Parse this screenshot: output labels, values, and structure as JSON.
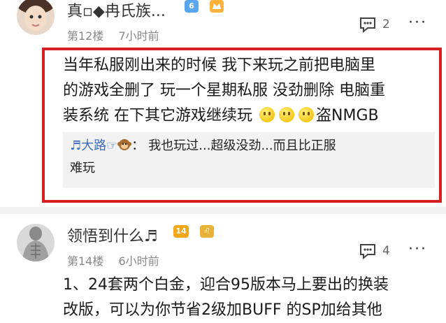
{
  "comments": [
    {
      "username": "真▫◆冉氏族...",
      "level_badge": "6",
      "floor": "第12楼",
      "time": "7小时前",
      "reply_count": "2",
      "content_lines": [
        "当年私服刚出来的时候 我下来玩之前把电脑里",
        "的游戏全删了 玩一个星期私服 没劲删除 电脑重",
        "装系统 在下其它游戏继续玩"
      ],
      "content_tail": "盗NMGB",
      "sub_reply": {
        "author": "♬大路☞",
        "separator": "：",
        "text_line1": "我也玩过...超级没劲...而且比正服",
        "text_line2": "难玩"
      }
    },
    {
      "username": "领悟到什么♬",
      "level_badge": "14",
      "zodiac_badge": "♌",
      "floor": "第14楼",
      "time": "6小时前",
      "reply_count": "4",
      "content_lines": [
        "1、24套两个白金，迎合95版本马上要出的换装",
        "改版，可以为你节省2级加BUFF 的SP加给其他"
      ]
    }
  ],
  "more_glyph": "···",
  "colors": {
    "highlight": "#d42020",
    "author_link": "#3d6cbf",
    "meta_gray": "#888888"
  },
  "icons": [
    "avatar",
    "level-badge",
    "emoji-icon",
    "reply-icon",
    "more-icon",
    "monkey-emoji-icon",
    "zodiac-badge"
  ]
}
